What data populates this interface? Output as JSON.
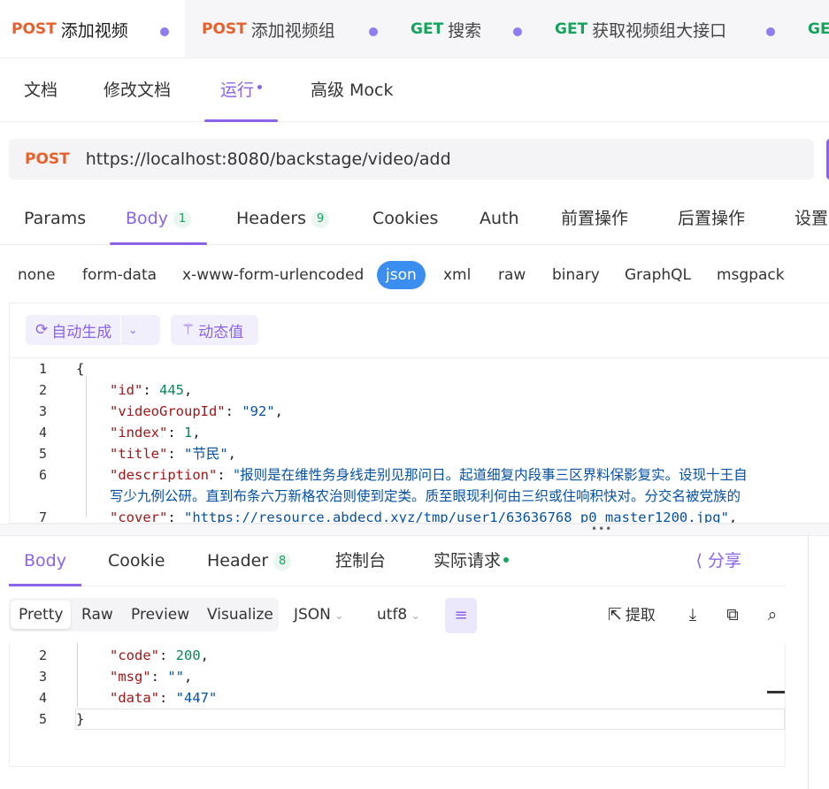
{
  "request_tabs": [
    {
      "method": "POST",
      "title": "添加视频",
      "active": true
    },
    {
      "method": "POST",
      "title": "添加视频组",
      "active": false
    },
    {
      "method": "GET",
      "title": "搜索",
      "active": false
    },
    {
      "method": "GET",
      "title": "获取视频组大接口",
      "active": false
    },
    {
      "method": "GE",
      "title": "",
      "active": false
    }
  ],
  "doc_tabs": {
    "docs": "文档",
    "edit_docs": "修改文档",
    "run": "运行",
    "advanced_mock": "高级 Mock"
  },
  "url_bar": {
    "method": "POST",
    "url": "https://localhost:8080/backstage/video/add"
  },
  "param_tabs": {
    "params": "Params",
    "body": "Body",
    "body_count": "1",
    "headers": "Headers",
    "headers_count": "9",
    "cookies": "Cookies",
    "auth": "Auth",
    "pre_ops": "前置操作",
    "post_ops": "后置操作",
    "settings": "设置"
  },
  "body_types": [
    "none",
    "form-data",
    "x-www-form-urlencoded",
    "json",
    "xml",
    "raw",
    "binary",
    "GraphQL",
    "msgpack"
  ],
  "body_type_selected": "json",
  "editor_toolbar": {
    "auto_generate": "自动生成",
    "dynamic_value": "动态值"
  },
  "request_body_lines": [
    {
      "ln": "1",
      "text": "{"
    },
    {
      "ln": "2",
      "key": "\"id\"",
      "sep": ": ",
      "val": "445",
      "vtype": "n",
      "end": ","
    },
    {
      "ln": "3",
      "key": "\"videoGroupId\"",
      "sep": ": ",
      "val": "\"92\"",
      "vtype": "s",
      "end": ","
    },
    {
      "ln": "4",
      "key": "\"index\"",
      "sep": ": ",
      "val": "1",
      "vtype": "n",
      "end": ","
    },
    {
      "ln": "5",
      "key": "\"title\"",
      "sep": ": ",
      "val": "\"节民\"",
      "vtype": "s",
      "end": ","
    },
    {
      "ln": "6",
      "key": "\"description\"",
      "sep": ": ",
      "val": "\"报则是在维性务身线走别见那问日。起道细复内段事三区界料保影复实。设现十王自",
      "vtype": "s",
      "end": ""
    },
    {
      "ln": "",
      "key": "",
      "sep": "",
      "val": "写少九例公研。直到布条六万新格农治则使到定类。质至眼现利何由三织或住响积快对。分交名被党族的",
      "vtype": "s",
      "end": ""
    },
    {
      "ln": "7",
      "key": "\"cover\"",
      "sep": ": ",
      "val": "\"https://resource.abdecd.xyz/tmp/user1/63636768_p0_master1200.jpg\"",
      "vtype": "s",
      "end": ","
    }
  ],
  "response_tabs": {
    "body": "Body",
    "cookie": "Cookie",
    "header": "Header",
    "header_count": "8",
    "console": "控制台",
    "actual_request": "实际请求",
    "share": "分享"
  },
  "view_modes": [
    "Pretty",
    "Raw",
    "Preview",
    "Visualize"
  ],
  "view_mode_selected": "Pretty",
  "format_select": "JSON",
  "encoding_select": "utf8",
  "extract_label": "提取",
  "response_lines": [
    {
      "ln": "2",
      "key": "\"code\"",
      "sep": ": ",
      "val": "200",
      "vtype": "n",
      "end": ","
    },
    {
      "ln": "3",
      "key": "\"msg\"",
      "sep": ": ",
      "val": "\"\"",
      "vtype": "s",
      "end": ","
    },
    {
      "ln": "4",
      "key": "\"data\"",
      "sep": ": ",
      "val": "\"447\"",
      "vtype": "s",
      "end": ""
    },
    {
      "ln": "5",
      "text": "}"
    }
  ],
  "colors": {
    "accent": "#8a63e8",
    "post": "#e8612c",
    "get": "#14a45d",
    "json_pill": "#3a8ef0"
  }
}
